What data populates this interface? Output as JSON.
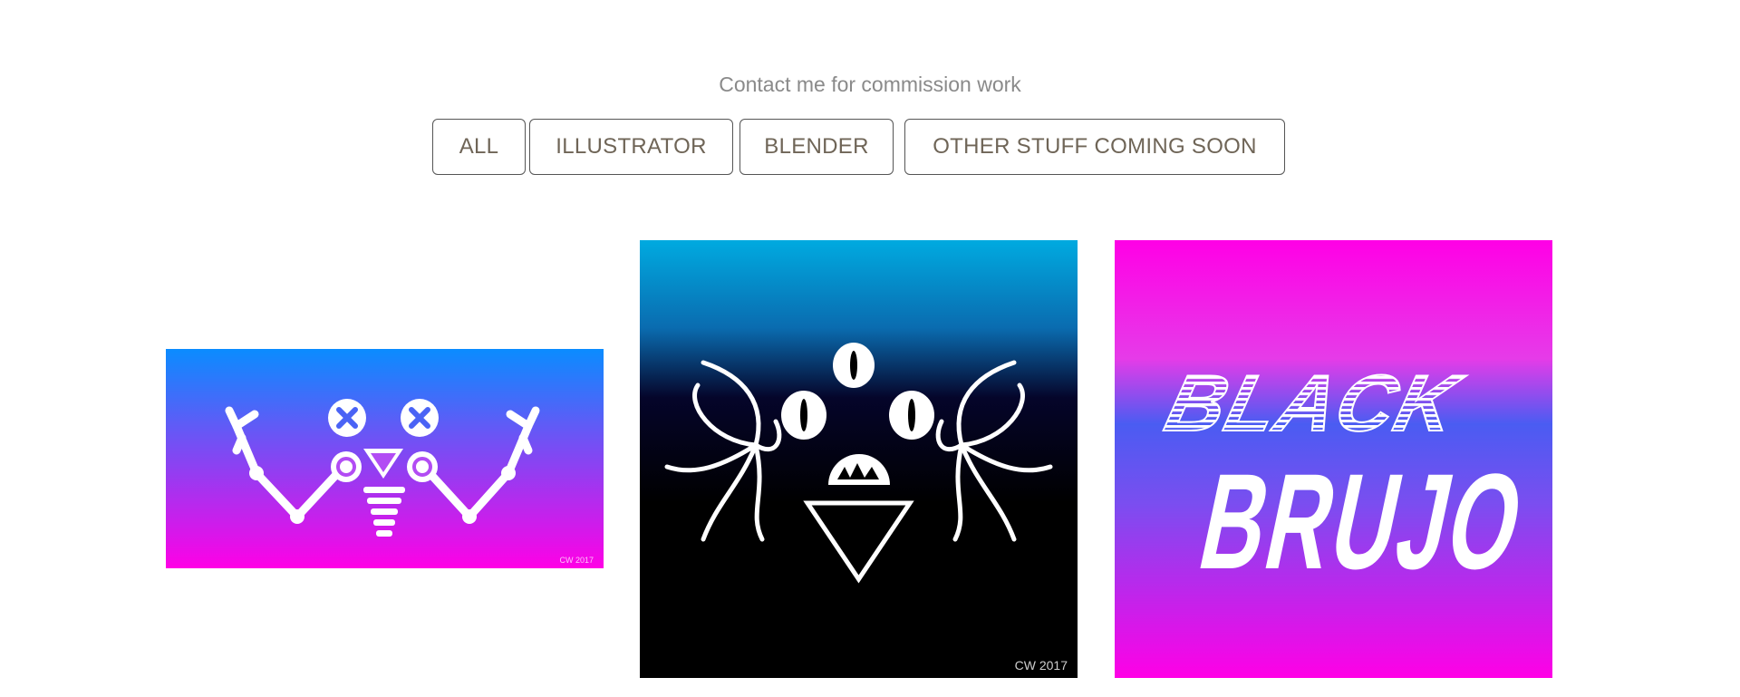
{
  "header": {
    "subtitle": "Contact me for commission work"
  },
  "filters": [
    {
      "label": "ALL"
    },
    {
      "label": "ILLUSTRATOR"
    },
    {
      "label": "BLENDER"
    },
    {
      "label": "OTHER STUFF COMING SOON"
    }
  ],
  "gallery": [
    {
      "signature": "CW 2017",
      "colors": {
        "top": "#0a8cff",
        "bottom": "#ff00e6"
      }
    },
    {
      "signature": "CW 2017",
      "colors": {
        "top": "#00aae0",
        "mid": "#05052a",
        "bottom": "#000000"
      }
    },
    {
      "title_line1": "BLACK",
      "title_line2": "BRUJO",
      "colors": {
        "top": "#ff00e6",
        "mid": "#4a5cf2",
        "bottom": "#ff00e6"
      }
    }
  ],
  "colors": {
    "button_text": "#6f6557",
    "subtitle": "#8a8a8a"
  }
}
